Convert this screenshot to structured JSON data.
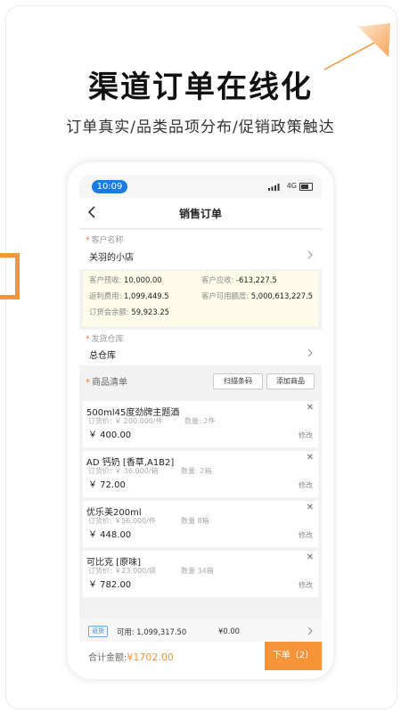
{
  "header": {
    "title": "渠道订单在线化",
    "subtitle": "订单真实/品类品项分布/促销政策触达"
  },
  "colors": {
    "accent": "#f7943a",
    "status_blue": "#1b7be0",
    "info_bg": "#fffcea"
  },
  "status_bar": {
    "time": "10:09",
    "network": "4G"
  },
  "nav": {
    "title": "销售订单",
    "back_icon": "chevron-left-icon"
  },
  "customer": {
    "label": "客户名称",
    "value": "关羽的小店"
  },
  "account": {
    "prepay_label": "客户预收:",
    "prepay_value": "10,000.00",
    "receivable_label": "客户应收:",
    "receivable_value": "-613,227.5",
    "rebate_label": "返利费用:",
    "rebate_value": "1,099,449.5",
    "available_label": "客户可用额度:",
    "available_value": "5,000,613,227.5",
    "balance_label": "订货会余额:",
    "balance_value": "59,923.25"
  },
  "warehouse": {
    "label": "发货仓库",
    "value": "总仓库"
  },
  "goods": {
    "label": "商品清单",
    "scan_button": "扫描条码",
    "add_button": "添加商品"
  },
  "items": [
    {
      "name": "500ml45度劲牌主题酒",
      "price_label": "订货价:",
      "unit_price": "￥ 200.000/件",
      "qty_label": "数量:",
      "qty": "2件",
      "total": "￥ 400.00",
      "edit": "修改"
    },
    {
      "name": "AD 钙奶 [香草,A1B2]",
      "price_label": "订货价:",
      "unit_price": "￥ 36.000/箱",
      "qty_label": "数量:",
      "qty": "2箱",
      "total": "￥ 72.00",
      "edit": "修改"
    },
    {
      "name": "优乐美200ml",
      "price_label": "订货价:",
      "unit_price": "￥56.000/件",
      "qty_label": "数量",
      "qty": "8箱",
      "total": "￥ 448.00",
      "edit": "修改"
    },
    {
      "name": "可比克 [原味]",
      "price_label": "订货价:",
      "unit_price": "￥23.000/袋",
      "qty_label": "数量",
      "qty": "34箱",
      "total": "￥ 782.00",
      "edit": "修改"
    }
  ],
  "rebate": {
    "tag": "返货",
    "available_label": "可用:",
    "available_value": "1,099,317.50",
    "used_value": "¥0.00"
  },
  "footer": {
    "total_label": "合计金额:",
    "total_value": "¥1702.00",
    "order_button": "下单（2）"
  }
}
